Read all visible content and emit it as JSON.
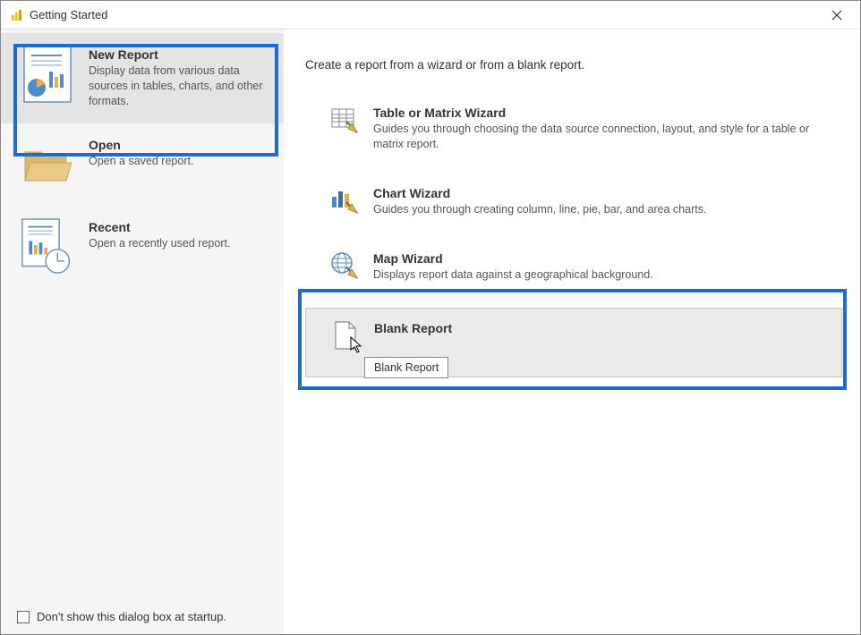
{
  "titlebar": {
    "title": "Getting Started"
  },
  "sidebar": {
    "items": [
      {
        "title": "New Report",
        "desc": "Display data from various data sources in tables, charts, and other formats."
      },
      {
        "title": "Open",
        "desc": "Open a saved report."
      },
      {
        "title": "Recent",
        "desc": "Open a recently used report."
      }
    ]
  },
  "main": {
    "heading": "Create a report from a wizard or from a blank report.",
    "options": [
      {
        "title": "Table or Matrix Wizard",
        "desc": "Guides you through choosing the data source connection, layout, and style for a table or matrix report."
      },
      {
        "title": "Chart Wizard",
        "desc": "Guides you through creating column, line, pie, bar, and area charts."
      },
      {
        "title": "Map Wizard",
        "desc": "Displays report data against a geographical background."
      },
      {
        "title": "Blank Report",
        "desc": ""
      }
    ],
    "tooltip": "Blank Report"
  },
  "footer": {
    "checkbox_label": "Don't show this dialog box at startup."
  }
}
